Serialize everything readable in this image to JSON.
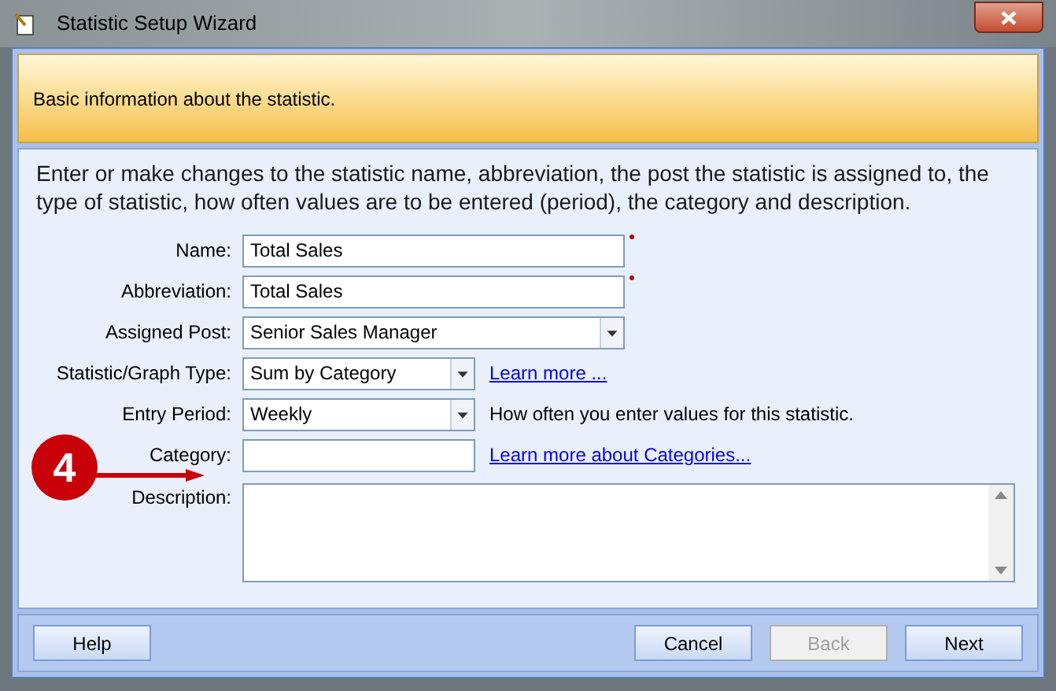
{
  "window": {
    "title": "Statistic Setup Wizard"
  },
  "header": {
    "text": "Basic information about the statistic."
  },
  "intro": "Enter or make changes to the statistic name, abbreviation, the post the statistic is assigned to, the type of statistic, how often values are to be entered (period), the category and description.",
  "fields": [
    {
      "label": "Name:",
      "kind": "text",
      "value": "Total Sales",
      "required": true
    },
    {
      "label": "Abbreviation:",
      "kind": "text",
      "value": "Total Sales",
      "required": true
    },
    {
      "label": "Assigned Post:",
      "kind": "select",
      "value": "Senior Sales Manager"
    },
    {
      "label": "Statistic/Graph Type:",
      "kind": "select",
      "value": "Sum by Category",
      "link": "Learn more ..."
    },
    {
      "label": "Entry Period:",
      "kind": "select",
      "value": "Weekly",
      "note": "How often you enter values for this statistic."
    },
    {
      "label": "Category:",
      "kind": "text",
      "link": "Learn more about Categories..."
    },
    {
      "label": "Description:",
      "kind": "textarea"
    }
  ],
  "callout": {
    "label": "4"
  },
  "buttons": [
    {
      "label": "Help",
      "disabled": false
    },
    {
      "label": "Cancel",
      "disabled": false
    },
    {
      "label": "Back",
      "disabled": true
    },
    {
      "label": "Next",
      "disabled": false
    }
  ]
}
